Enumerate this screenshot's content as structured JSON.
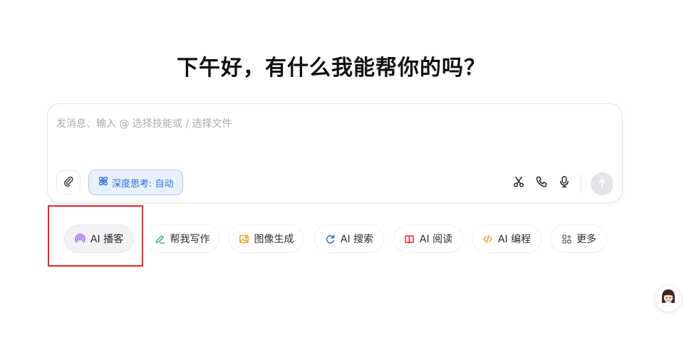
{
  "greeting": "下午好，有什么我能帮你的吗？",
  "composer": {
    "placeholder": "发消息、输入 @ 选择技能或 / 选择文件",
    "value": "",
    "deep_think_label": "深度思考: 自动",
    "icons": {
      "attach": "paperclip-icon",
      "deep_think": "atom-icon",
      "scissors": "scissors-icon",
      "phone": "phone-icon",
      "mic": "microphone-icon",
      "send": "arrow-up-icon"
    }
  },
  "skills": [
    {
      "label": "AI 播客",
      "icon": "podcast-icon",
      "color": "#9b5de5",
      "active": true
    },
    {
      "label": "帮我写作",
      "icon": "pen-icon",
      "color": "#2fb36a"
    },
    {
      "label": "图像生成",
      "icon": "image-icon",
      "color": "#e8a317"
    },
    {
      "label": "AI 搜索",
      "icon": "search-refresh-icon",
      "color": "#2e6fd8"
    },
    {
      "label": "AI 阅读",
      "icon": "reader-icon",
      "color": "#e0262a"
    },
    {
      "label": "AI 编程",
      "icon": "code-icon",
      "color": "#f0a020"
    },
    {
      "label": "更多",
      "icon": "grid-icon",
      "color": "#666666"
    }
  ],
  "colors": {
    "accent": "#2e6fd8",
    "highlight": "#e0262a"
  }
}
